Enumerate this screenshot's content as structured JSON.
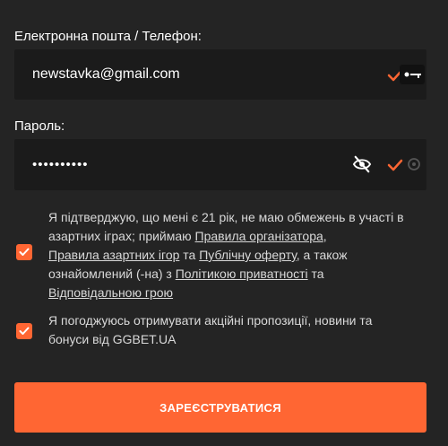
{
  "email": {
    "label": "Електронна пошта / Телефон:",
    "value": "newstavka@gmail.com"
  },
  "password": {
    "label": "Пароль:",
    "value": "••••••••••"
  },
  "consent": {
    "p1": "Я підтверджую, що мені є 21 рік, не маю обмежень в участі в азартних іграх; приймаю ",
    "link1": "Правила організатора",
    "p2": ",",
    "link2": "Правила азартних ігор",
    "p3": " та ",
    "link3": "Публічну оферту",
    "p4": ", а також ознайомлений (-на) з ",
    "link4": "Політикою приватності",
    "p5": " та ",
    "link5": "Відповідальною грою"
  },
  "promo": {
    "text": "Я погоджуюсь отримувати акційні пропозиції, новини та бонуси від GGBET.UA"
  },
  "submit_label": "ЗАРЕЄСТРУВАТИСЯ",
  "colors": {
    "accent": "#ff6633",
    "background": "#242424",
    "field": "#1b1b1b"
  }
}
